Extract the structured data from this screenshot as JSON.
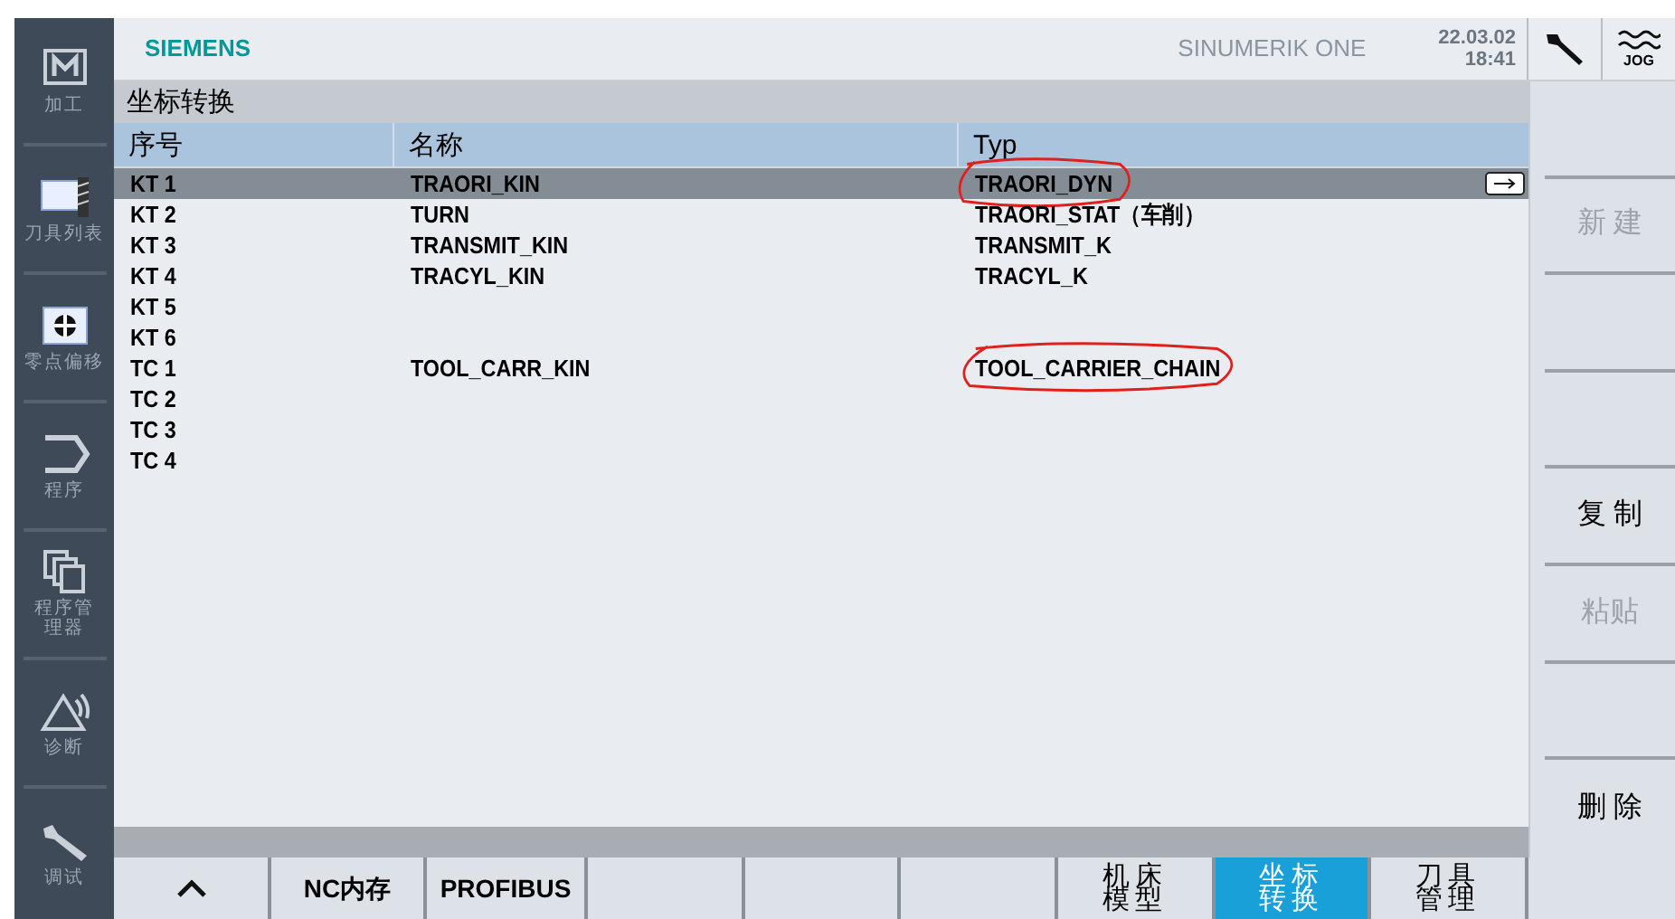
{
  "header": {
    "brand": "SIEMENS",
    "product": "SINUMERIK ONE",
    "date": "22.03.02",
    "time": "18:41",
    "mode": "JOG"
  },
  "sidebar": {
    "items": [
      {
        "kind": "machine",
        "label": "加工"
      },
      {
        "kind": "toollist",
        "label": "刀具列表"
      },
      {
        "kind": "offset",
        "label": "零点偏移"
      },
      {
        "kind": "program",
        "label": "程序"
      },
      {
        "kind": "manager",
        "label": "程序管理器"
      },
      {
        "kind": "diagnosis",
        "label": "诊断"
      },
      {
        "kind": "setup",
        "label": "调试"
      }
    ]
  },
  "page_title": "坐标转换",
  "table": {
    "columns": [
      "序号",
      "名称",
      "Typ"
    ],
    "rows": [
      {
        "number": "KT 1",
        "name": "TRAORI_KIN",
        "type": "TRAORI_DYN",
        "selected": true,
        "circled": true
      },
      {
        "number": "KT 2",
        "name": "TURN",
        "type": "TRAORI_STAT（车削）",
        "selected": false,
        "circled": false
      },
      {
        "number": "KT 3",
        "name": "TRANSMIT_KIN",
        "type": "TRANSMIT_K",
        "selected": false,
        "circled": false
      },
      {
        "number": "KT 4",
        "name": "TRACYL_KIN",
        "type": "TRACYL_K",
        "selected": false,
        "circled": false
      },
      {
        "number": "KT 5",
        "selected": false,
        "circled": false
      },
      {
        "number": "KT 6",
        "selected": false,
        "circled": false
      },
      {
        "number": "TC 1",
        "name": "TOOL_CARR_KIN",
        "type": "TOOL_CARRIER_CHAIN",
        "selected": false,
        "circled": true
      },
      {
        "number": "TC 2",
        "selected": false,
        "circled": false
      },
      {
        "number": "TC 3",
        "selected": false,
        "circled": false
      },
      {
        "number": "TC 4",
        "selected": false,
        "circled": false
      }
    ]
  },
  "vertical_softkeys": [
    {
      "kind": "blank"
    },
    {
      "kind": "key",
      "label": "新 建",
      "disabled": true
    },
    {
      "kind": "blank"
    },
    {
      "kind": "blank"
    },
    {
      "kind": "key",
      "label": "复 制",
      "disabled": false
    },
    {
      "kind": "key",
      "label": "粘贴",
      "disabled": true
    },
    {
      "kind": "blank"
    },
    {
      "kind": "key",
      "label": "删 除",
      "disabled": false
    }
  ],
  "horizontal_softkeys": [
    {
      "kind": "up",
      "selected": false
    },
    {
      "kind": "key",
      "label": "NC内存",
      "selected": false
    },
    {
      "kind": "key",
      "label": "PROFIBUS",
      "selected": false
    },
    {
      "kind": "blank",
      "selected": false
    },
    {
      "kind": "blank",
      "selected": false
    },
    {
      "kind": "blank",
      "selected": false
    },
    {
      "kind": "stack",
      "label": "机床模型",
      "selected": false
    },
    {
      "kind": "stack",
      "label": "坐标转换",
      "selected": true
    },
    {
      "kind": "stack",
      "label": "刀具管理",
      "selected": false
    }
  ]
}
